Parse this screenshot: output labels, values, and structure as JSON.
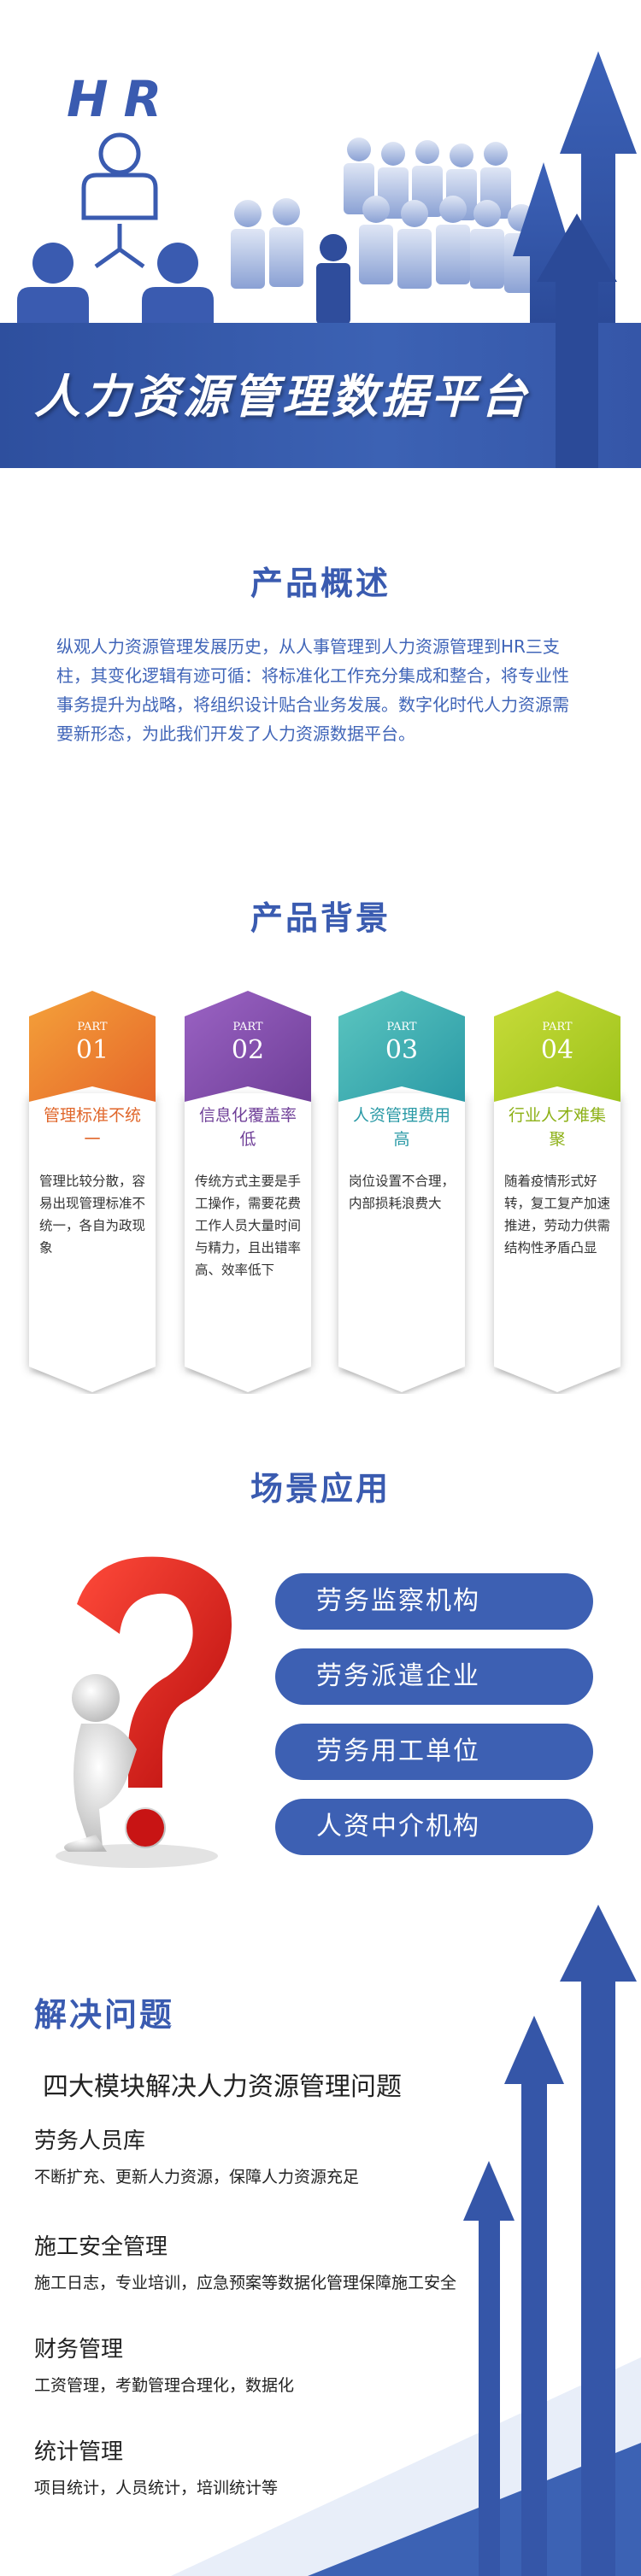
{
  "hero": {
    "hr": "HR",
    "title": "人力资源管理数据平台"
  },
  "overview": {
    "title": "产品概述",
    "text": "纵观人力资源管理发展历史，从人事管理到人力资源管理到HR三支柱，其变化逻辑有迹可循：将标准化工作充分集成和整合，将专业性事务提升为战略，将组织设计贴合业务发展。数字化时代人力资源需要新形态，为此我们开发了人力资源数据平台。"
  },
  "background": {
    "title": "产品背景",
    "cards": [
      {
        "part": "PART",
        "num": "01",
        "title": "管理标准不统一",
        "desc": "管理比较分散，容易出现管理标准不统一，各自为政现象",
        "color": "#e6672a",
        "color2": "#f4a23a",
        "text_color": "#e0662a"
      },
      {
        "part": "PART",
        "num": "02",
        "title": "信息化覆盖率低",
        "desc": "传统方式主要是手工操作，需要花费工作人员大量时间与精力，且出错率高、效率低下",
        "color": "#6f3f98",
        "color2": "#9b63c4",
        "text_color": "#6f3f98"
      },
      {
        "part": "PART",
        "num": "03",
        "title": "人资管理费用高",
        "desc": "岗位设置不合理，内部损耗浪费大",
        "color": "#2a9aa6",
        "color2": "#5cc6c0",
        "text_color": "#2a9aa6"
      },
      {
        "part": "PART",
        "num": "04",
        "title": "行业人才难集聚",
        "desc": "随着疫情形式好转，复工复产加速推进，劳动力供需结构性矛盾凸显",
        "color": "#9cc21a",
        "color2": "#c8dc3a",
        "text_color": "#8cb015"
      }
    ]
  },
  "scenes": {
    "title": "场景应用",
    "items": [
      "劳务监察机构",
      "劳务派遣企业",
      "劳务用工单位",
      "人资中介机构"
    ]
  },
  "solve": {
    "title": "解决问题",
    "subtitle": "四大模块解决人力资源管理问题",
    "modules": [
      {
        "title": "劳务人员库",
        "desc": "不断扩充、更新人力资源，保障人力资源充足"
      },
      {
        "title": "施工安全管理",
        "desc": "施工日志，专业培训，应急预案等数据化管理保障施工安全"
      },
      {
        "title": "财务管理",
        "desc": "工资管理，考勤管理合理化，数据化"
      },
      {
        "title": "统计管理",
        "desc": "项目统计，人员统计，培训统计等"
      }
    ]
  },
  "colors": {
    "brand": "#3a5bb0",
    "band": "#3556a8"
  }
}
